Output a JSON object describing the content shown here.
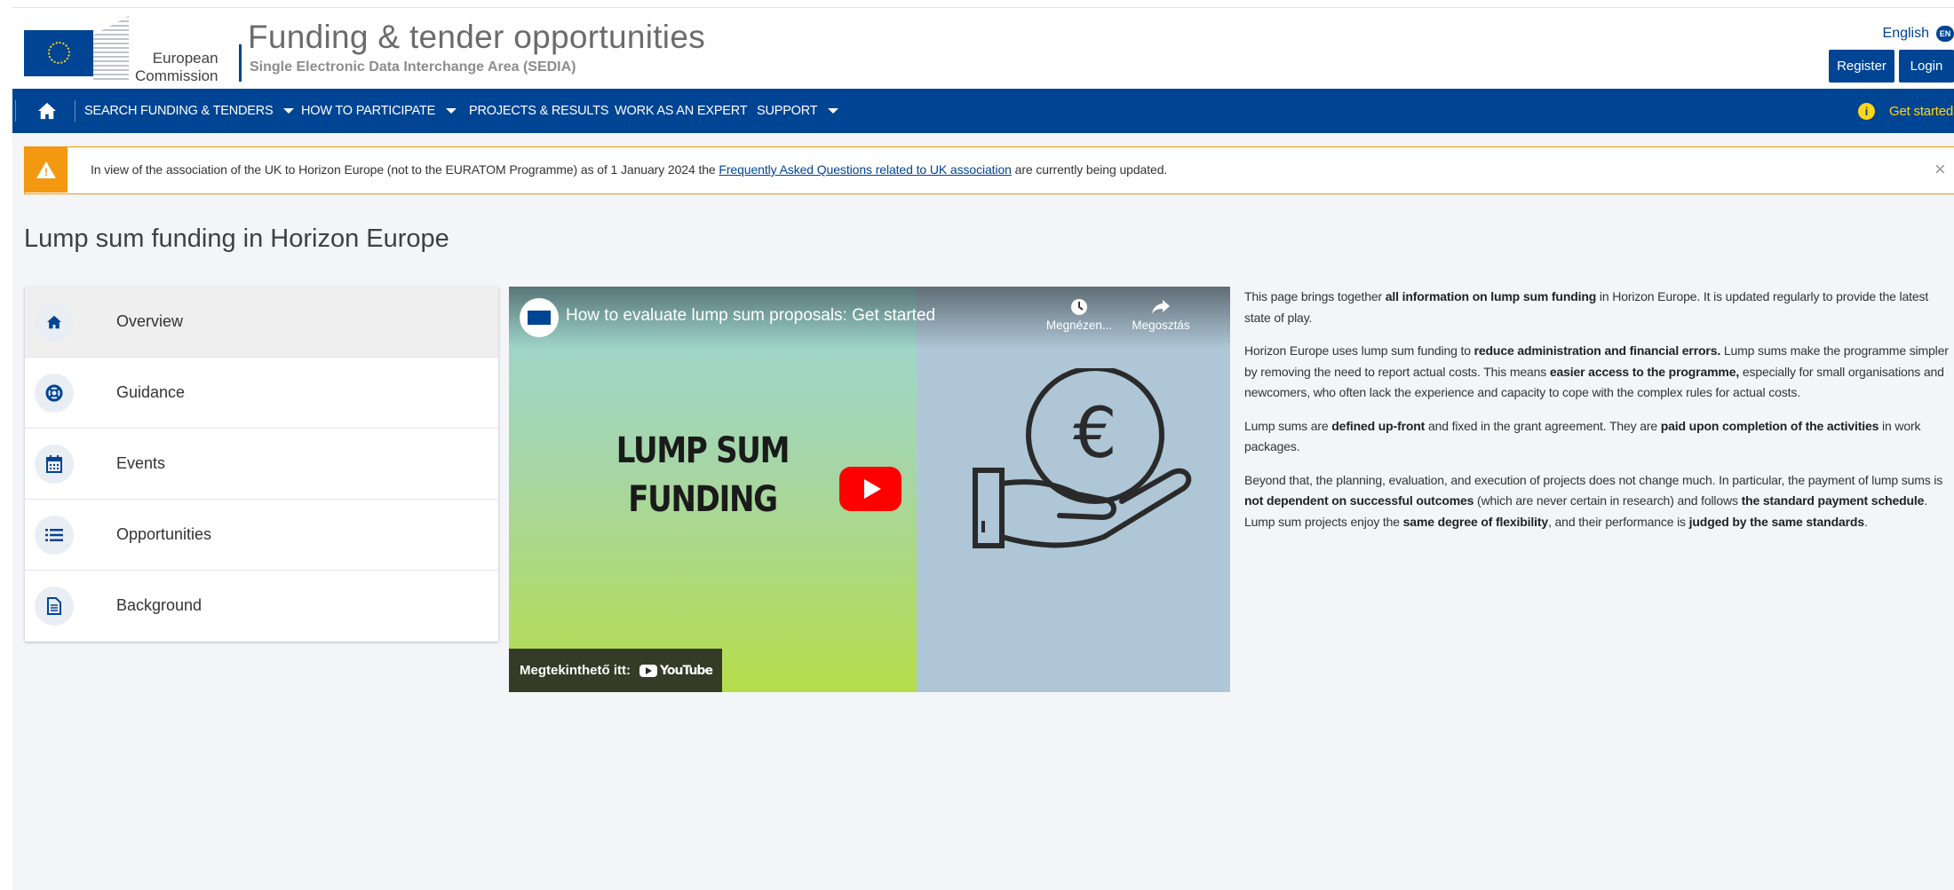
{
  "header": {
    "logo_line1": "European",
    "logo_line2": "Commission",
    "title": "Funding & tender opportunities",
    "subtitle": "Single Electronic Data Interchange Area (SEDIA)",
    "language": "English",
    "language_code": "EN",
    "register_label": "Register",
    "login_label": "Login"
  },
  "nav": {
    "items": [
      {
        "label": "SEARCH FUNDING & TENDERS"
      },
      {
        "label": "HOW TO PARTICIPATE"
      },
      {
        "label": "PROJECTS & RESULTS"
      },
      {
        "label": "WORK AS AN EXPERT"
      },
      {
        "label": "SUPPORT"
      }
    ],
    "get_started_label": "Get started"
  },
  "alert": {
    "text_before": "In view of the association of the UK to Horizon Europe (not to the EURATOM Programme) as of 1 January 2024 the ",
    "link_text": "Frequently Asked Questions related to UK association",
    "text_after": " are currently being updated.",
    "close_symbol": "×"
  },
  "page_title": "Lump sum funding in Horizon Europe",
  "side_menu": {
    "items": [
      {
        "label": "Overview",
        "icon": "home-icon",
        "active": true
      },
      {
        "label": "Guidance",
        "icon": "life-ring-icon"
      },
      {
        "label": "Events",
        "icon": "calendar-icon"
      },
      {
        "label": "Opportunities",
        "icon": "list-icon"
      },
      {
        "label": "Background",
        "icon": "document-icon"
      }
    ]
  },
  "video": {
    "title": "How to evaluate lump sum proposals: Get started",
    "watch_later_label": "Megnézen...",
    "share_label": "Megosztás",
    "big_text_line1": "LUMP SUM",
    "big_text_line2": "FUNDING",
    "watch_on_label": "Megtekinthető itt:",
    "youtube_label": "YouTube",
    "euro_symbol": "€"
  },
  "content": {
    "p1": [
      {
        "t": "This page brings together "
      },
      {
        "t": "all information on lump sum funding",
        "b": true
      },
      {
        "t": " in Horizon Europe. It is updated regularly to provide the latest state of play."
      }
    ],
    "p2": [
      {
        "t": "Horizon Europe uses lump sum funding to "
      },
      {
        "t": "reduce administration and financial errors.",
        "b": true
      },
      {
        "t": " Lump sums make the programme simpler by removing the need to report actual costs. This means "
      },
      {
        "t": "easier access to the programme,",
        "b": true
      },
      {
        "t": " especially for small organisations and newcomers, who often lack the experience and capacity to cope with the complex rules for actual costs."
      }
    ],
    "p3": [
      {
        "t": "Lump sums are "
      },
      {
        "t": "defined up-front",
        "b": true
      },
      {
        "t": " and fixed in the grant agreement. They are "
      },
      {
        "t": "paid upon completion of the activities",
        "b": true
      },
      {
        "t": " in work packages."
      }
    ],
    "p4": [
      {
        "t": "Beyond that, the planning, evaluation, and execution of projects does not change much. In particular, the payment of lump sums is "
      },
      {
        "t": "not dependent on successful outcomes",
        "b": true
      },
      {
        "t": " (which are never certain in research) and follows "
      },
      {
        "t": "the standard payment schedule",
        "b": true
      },
      {
        "t": ". Lump sum projects enjoy the "
      },
      {
        "t": "same degree of flexibility",
        "b": true
      },
      {
        "t": ", and their performance is "
      },
      {
        "t": "judged by the same standards",
        "b": true
      },
      {
        "t": "."
      }
    ]
  },
  "colors": {
    "brand_blue": "#004494",
    "warning_orange": "#f39811",
    "accent_yellow": "#ffd617",
    "youtube_red": "#ff0000"
  }
}
